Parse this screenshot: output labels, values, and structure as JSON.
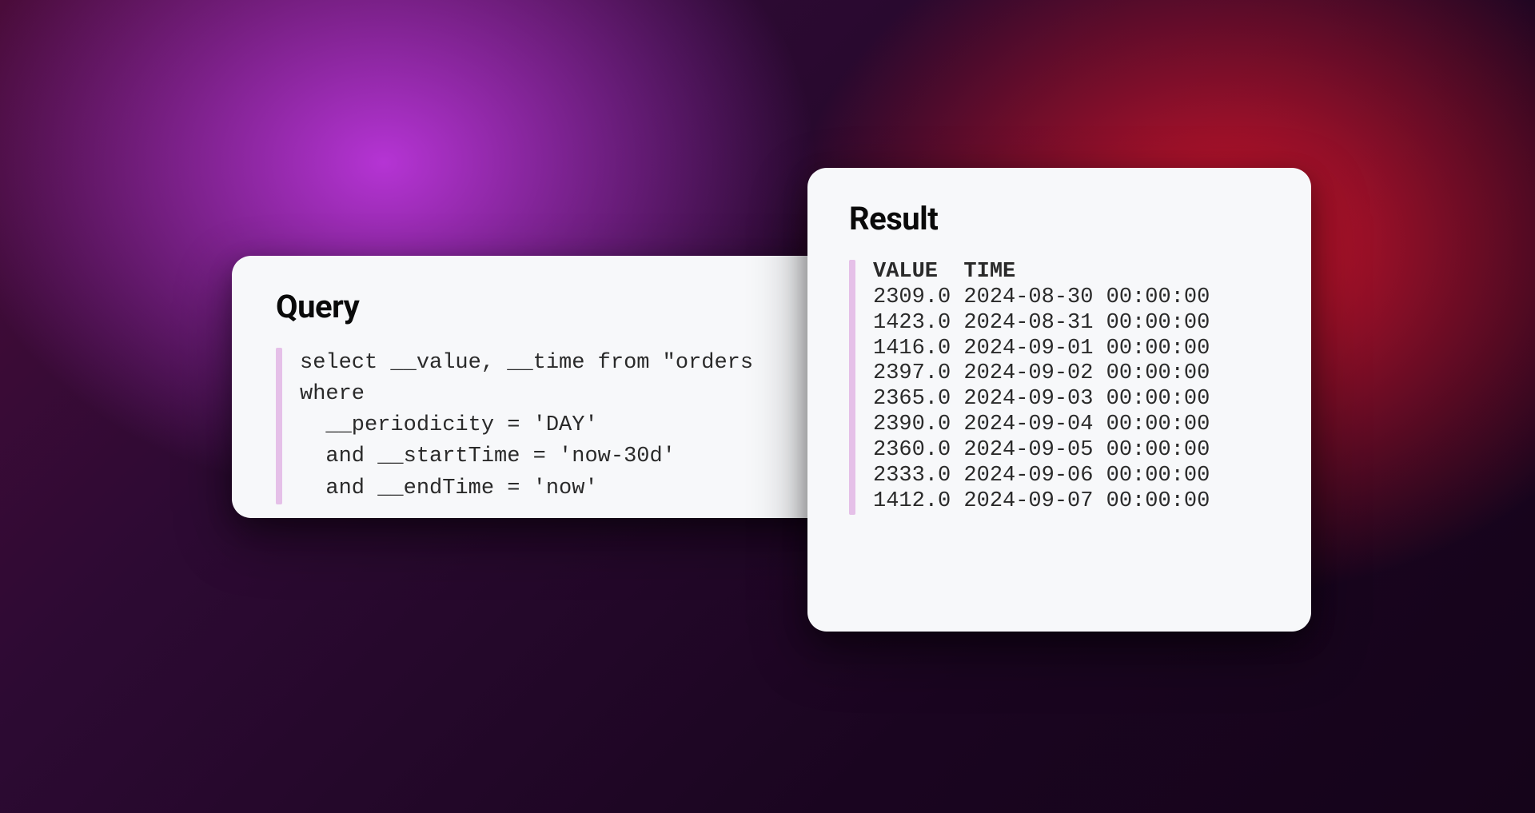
{
  "query": {
    "title": "Query",
    "code": "select __value, __time from \"orders\nwhere\n  __periodicity = 'DAY'\n  and __startTime = 'now-30d'\n  and __endTime = 'now'"
  },
  "result": {
    "title": "Result",
    "headers": {
      "value": "VALUE",
      "time": "TIME"
    },
    "rows": [
      {
        "value": "2309.0",
        "time": "2024-08-30 00:00:00"
      },
      {
        "value": "1423.0",
        "time": "2024-08-31 00:00:00"
      },
      {
        "value": "1416.0",
        "time": "2024-09-01 00:00:00"
      },
      {
        "value": "2397.0",
        "time": "2024-09-02 00:00:00"
      },
      {
        "value": "2365.0",
        "time": "2024-09-03 00:00:00"
      },
      {
        "value": "2390.0",
        "time": "2024-09-04 00:00:00"
      },
      {
        "value": "2360.0",
        "time": "2024-09-05 00:00:00"
      },
      {
        "value": "2333.0",
        "time": "2024-09-06 00:00:00"
      },
      {
        "value": "1412.0",
        "time": "2024-09-07 00:00:00"
      }
    ]
  }
}
